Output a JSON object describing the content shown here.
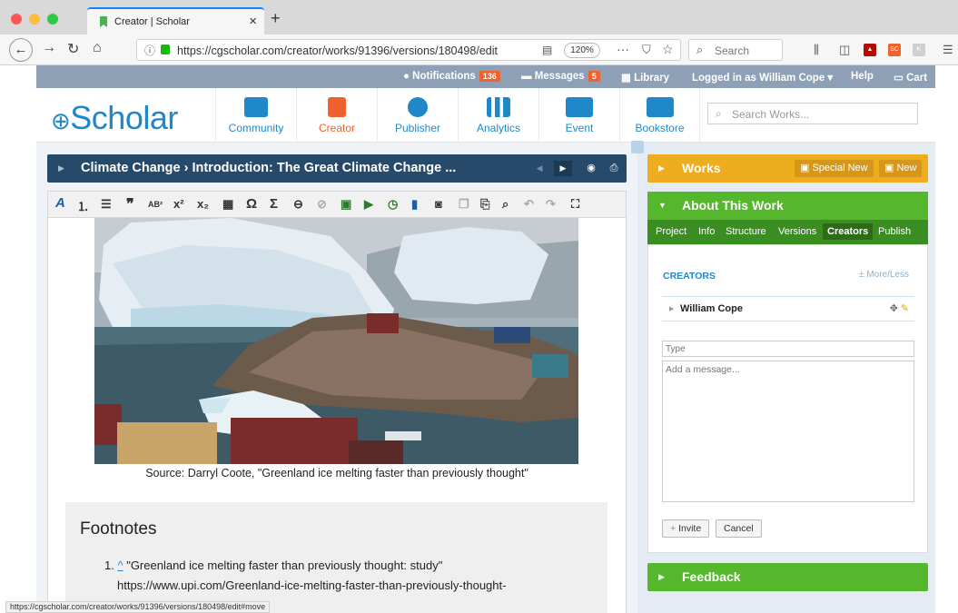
{
  "browser": {
    "tab_title": "Creator | Scholar",
    "url": "https://cgscholar.com/creator/works/91396/versions/180498/edit",
    "zoom": "120%",
    "search_placeholder": "Search",
    "status_url": "https://cgscholar.com/creator/works/91396/versions/180498/edit#move"
  },
  "topbar": {
    "notifications_label": "Notifications",
    "notifications_count": "136",
    "messages_label": "Messages",
    "messages_count": "5",
    "library_label": "Library",
    "logged_in": "Logged in as William Cope",
    "help": "Help",
    "cart": "Cart"
  },
  "header": {
    "logo": "Scholar",
    "nav": [
      {
        "label": "Community",
        "icon": "community-icon",
        "color": "#1e88c8"
      },
      {
        "label": "Creator",
        "icon": "creator-icon",
        "color": "#f0622d"
      },
      {
        "label": "Publisher",
        "icon": "publisher-icon",
        "color": "#1e88c8"
      },
      {
        "label": "Analytics",
        "icon": "analytics-icon",
        "color": "#1e88c8"
      },
      {
        "label": "Event",
        "icon": "event-icon",
        "color": "#1e88c8"
      },
      {
        "label": "Bookstore",
        "icon": "bookstore-icon",
        "color": "#1e88c8"
      }
    ],
    "search_placeholder": "Search Works..."
  },
  "editor": {
    "breadcrumb": "Climate Change › Introduction: The Great Climate Change ...",
    "caption": "Source: Darryl Coote, \"Greenland ice melting faster than previously thought\"",
    "footnotes_title": "Footnotes",
    "footnote_1_num": "1.",
    "footnote_1_caret": "^",
    "footnote_1_text": "\"Greenland ice melting faster than previously thought: study\"",
    "footnote_1_url": "https://www.upi.com/Greenland-ice-melting-faster-than-previously-thought-"
  },
  "sidebar": {
    "works_title": "Works",
    "special_new": "Special New",
    "new": "New",
    "about_title": "About This Work",
    "tabs": [
      "Project",
      "Info",
      "Structure",
      "Versions",
      "Creators",
      "Publish"
    ],
    "active_tab": "Creators",
    "creators_label": "CREATORS",
    "more_less": "± More/Less",
    "creator_name": "William Cope",
    "type_placeholder": "Type",
    "message_placeholder": "Add a message...",
    "invite": "Invite",
    "cancel": "Cancel",
    "feedback_title": "Feedback"
  },
  "colors": {
    "brand_blue": "#1e88c8",
    "works_yellow": "#eeac1f",
    "about_green": "#55b72b",
    "breadcrumb_navy": "#274a6b",
    "badge_orange": "#f0622d"
  }
}
